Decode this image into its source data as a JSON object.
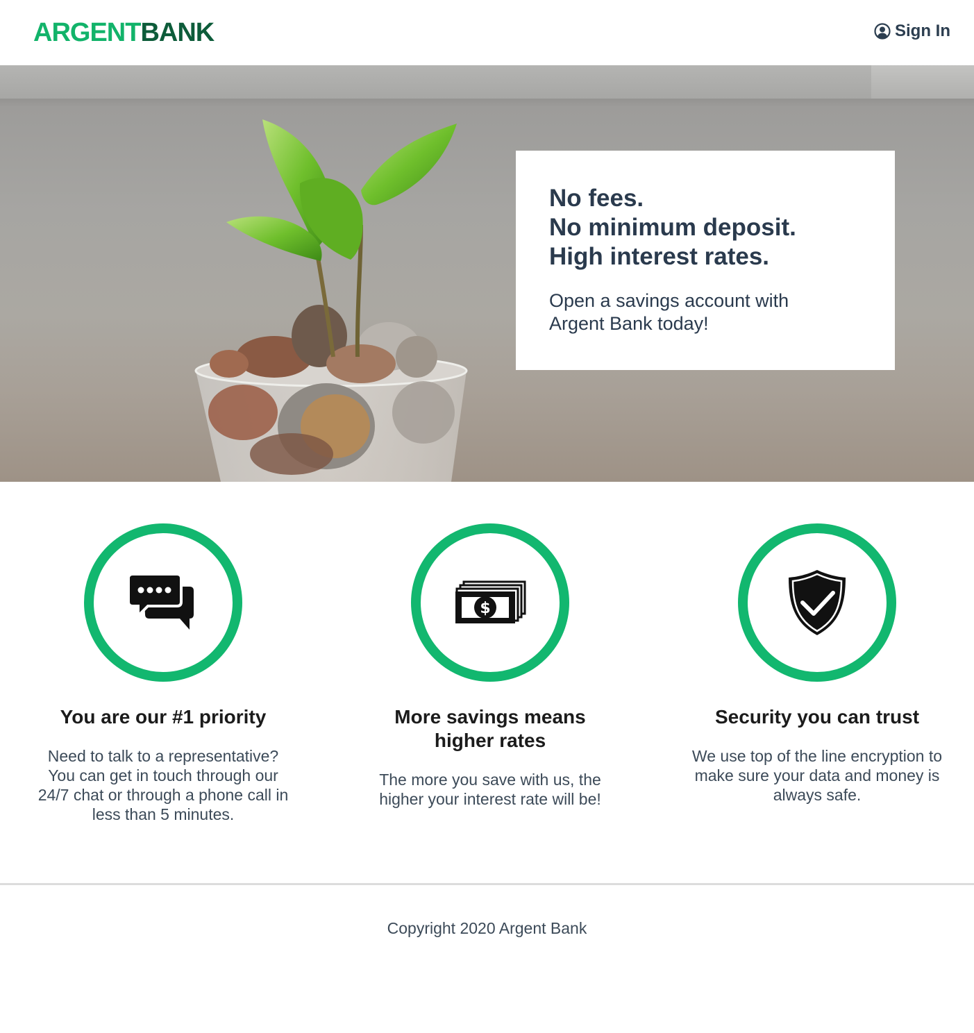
{
  "header": {
    "logo_part1": "ARGENT",
    "logo_part2": "BANK",
    "signin_label": "Sign In",
    "colors": {
      "logo_accent": "#12b36a",
      "logo_dark": "#0d5c3a"
    }
  },
  "hero": {
    "headline_lines": [
      "No fees.",
      "No minimum deposit.",
      "High interest rates."
    ],
    "subtext": "Open a savings account with Argent Bank today!",
    "image": "plant-growing-in-jar-of-coins"
  },
  "features": [
    {
      "icon": "chat-bubbles-icon",
      "title": "You are our #1 priority",
      "text": "Need to talk to a representative? You can get in touch through our 24/7 chat or through a phone call in less than 5 minutes."
    },
    {
      "icon": "money-stack-icon",
      "title": "More savings means higher rates",
      "text": "The more you save with us, the higher your interest rate will be!"
    },
    {
      "icon": "shield-check-icon",
      "title": "Security you can trust",
      "text": "We use top of the line encryption to make sure your data and money is always safe."
    }
  ],
  "footer": {
    "copyright": "Copyright 2020 Argent Bank"
  },
  "colors": {
    "accent": "#12b76f",
    "text": "#2c3e50"
  }
}
